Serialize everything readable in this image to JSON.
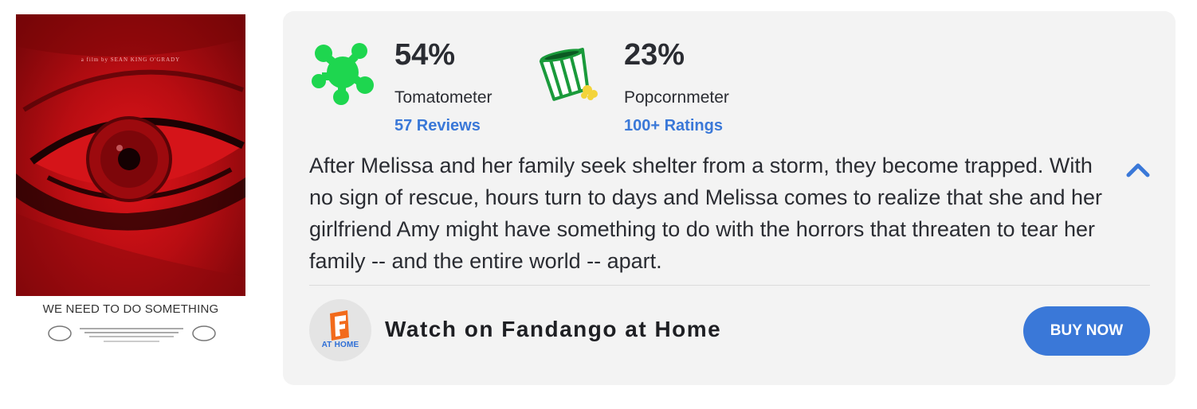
{
  "poster": {
    "credit": "a film by SEAN KING O'GRADY",
    "title": "WE NEED TO DO SOMETHING"
  },
  "tomatometer": {
    "icon": "splat-icon",
    "value": "54%",
    "label": "Tomatometer",
    "reviews_link": "57 Reviews",
    "color": "#1ed64f"
  },
  "popcornmeter": {
    "icon": "spilled-popcorn-icon",
    "value": "23%",
    "label": "Popcornmeter",
    "ratings_link": "100+ Ratings",
    "color": "#1a9a3b"
  },
  "synopsis": {
    "text": "After Melissa and her family seek shelter from a storm, they become trapped. With no sign of rescue, hours turn to days and Melissa comes to realize that she and her girlfriend Amy might have something to do with the horrors that threaten to tear her family -- and the entire world -- apart.",
    "toggle_icon": "chevron-up-icon"
  },
  "watch": {
    "logo_label": "AT HOME",
    "label": "Watch on Fandango at Home",
    "button_label": "BUY NOW",
    "accent": "#3a78d8"
  }
}
